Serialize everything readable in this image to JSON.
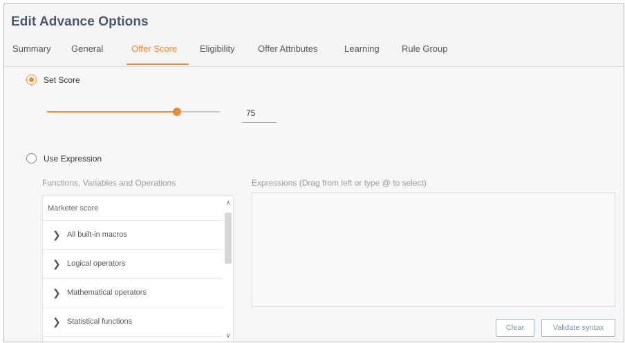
{
  "dialog": {
    "title": "Edit Advance Options"
  },
  "tabs": [
    {
      "label": "Summary"
    },
    {
      "label": "General"
    },
    {
      "label": "Offer Score",
      "active": true
    },
    {
      "label": "Eligibility"
    },
    {
      "label": "Offer Attributes"
    },
    {
      "label": "Learning"
    },
    {
      "label": "Rule Group"
    }
  ],
  "set_score": {
    "label": "Set Score",
    "selected": true,
    "slider_value": 75,
    "value_text": "75"
  },
  "use_expression": {
    "label": "Use Expression",
    "selected": false
  },
  "functions_panel": {
    "heading": "Functions, Variables and Operations",
    "search_value": "Marketer score",
    "items": [
      {
        "label": "All built-in macros"
      },
      {
        "label": "Logical operators"
      },
      {
        "label": "Mathematical operators"
      },
      {
        "label": "Statistical functions"
      }
    ]
  },
  "expressions_panel": {
    "heading": "Expressions (Drag from left or type @ to select)",
    "value": ""
  },
  "buttons": {
    "clear": "Clear",
    "validate": "Validate syntax"
  },
  "colors": {
    "accent": "#ee8b35",
    "title": "#4a5a6e",
    "button_text": "#7a95b0"
  },
  "icons": {
    "chevron": "chevron-right-icon",
    "scroll_up": "chevron-up-icon",
    "scroll_down": "chevron-down-icon"
  }
}
